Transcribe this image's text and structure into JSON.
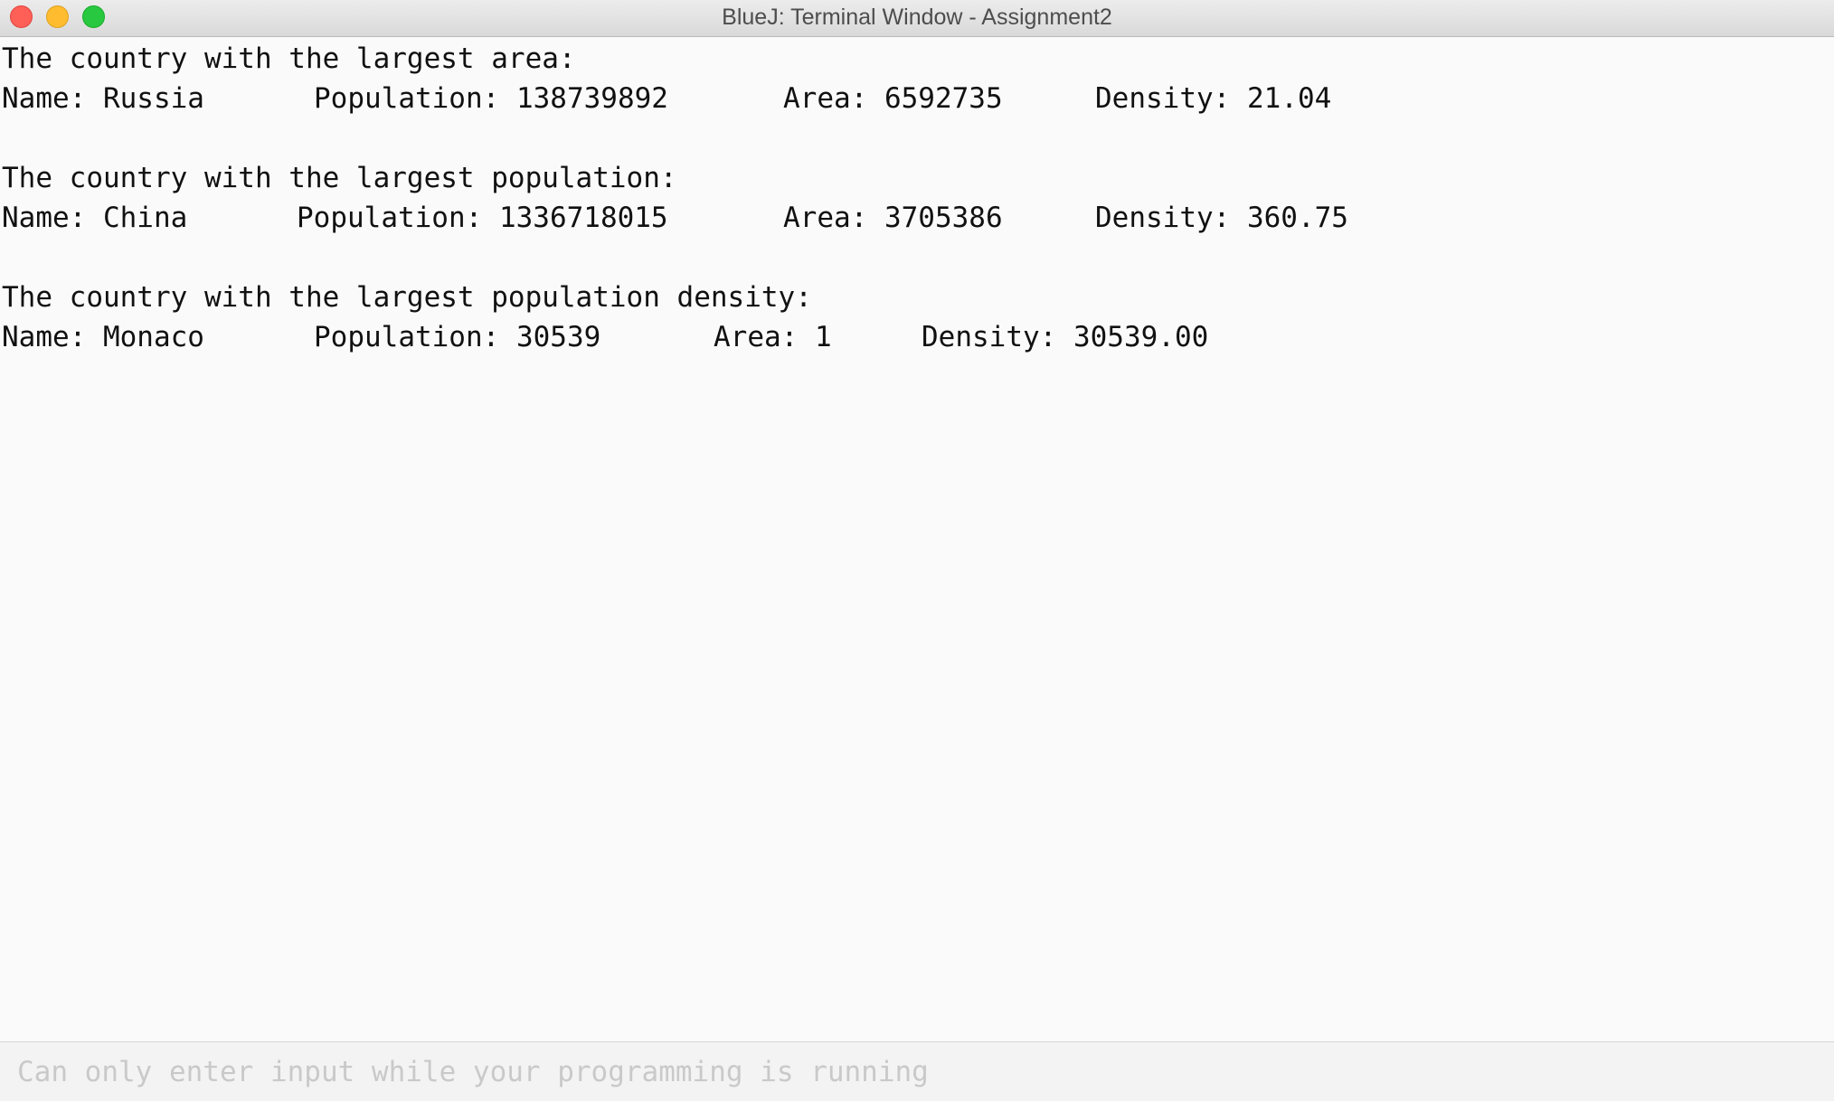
{
  "window": {
    "title": "BlueJ: Terminal Window - Assignment2"
  },
  "colors": {
    "close": "#fe5f57",
    "minimize": "#febc2e",
    "zoom": "#28c840"
  },
  "output": {
    "sections": [
      {
        "heading": "The country with the largest area:",
        "name": "Name: Russia",
        "population": "Population: 138739892",
        "area": "Area: 6592735",
        "density": "Density: 21.04"
      },
      {
        "heading": "The country with the largest population:",
        "name": "Name: China",
        "population": "Population: 1336718015",
        "area": "Area: 3705386",
        "density": "Density: 360.75"
      },
      {
        "heading": "The country with the largest population density:",
        "name": "Name: Monaco",
        "population": "Population: 30539",
        "area": "Area: 1",
        "density": "Density: 30539.00"
      }
    ]
  },
  "input": {
    "placeholder": "Can only enter input while your programming is running"
  }
}
